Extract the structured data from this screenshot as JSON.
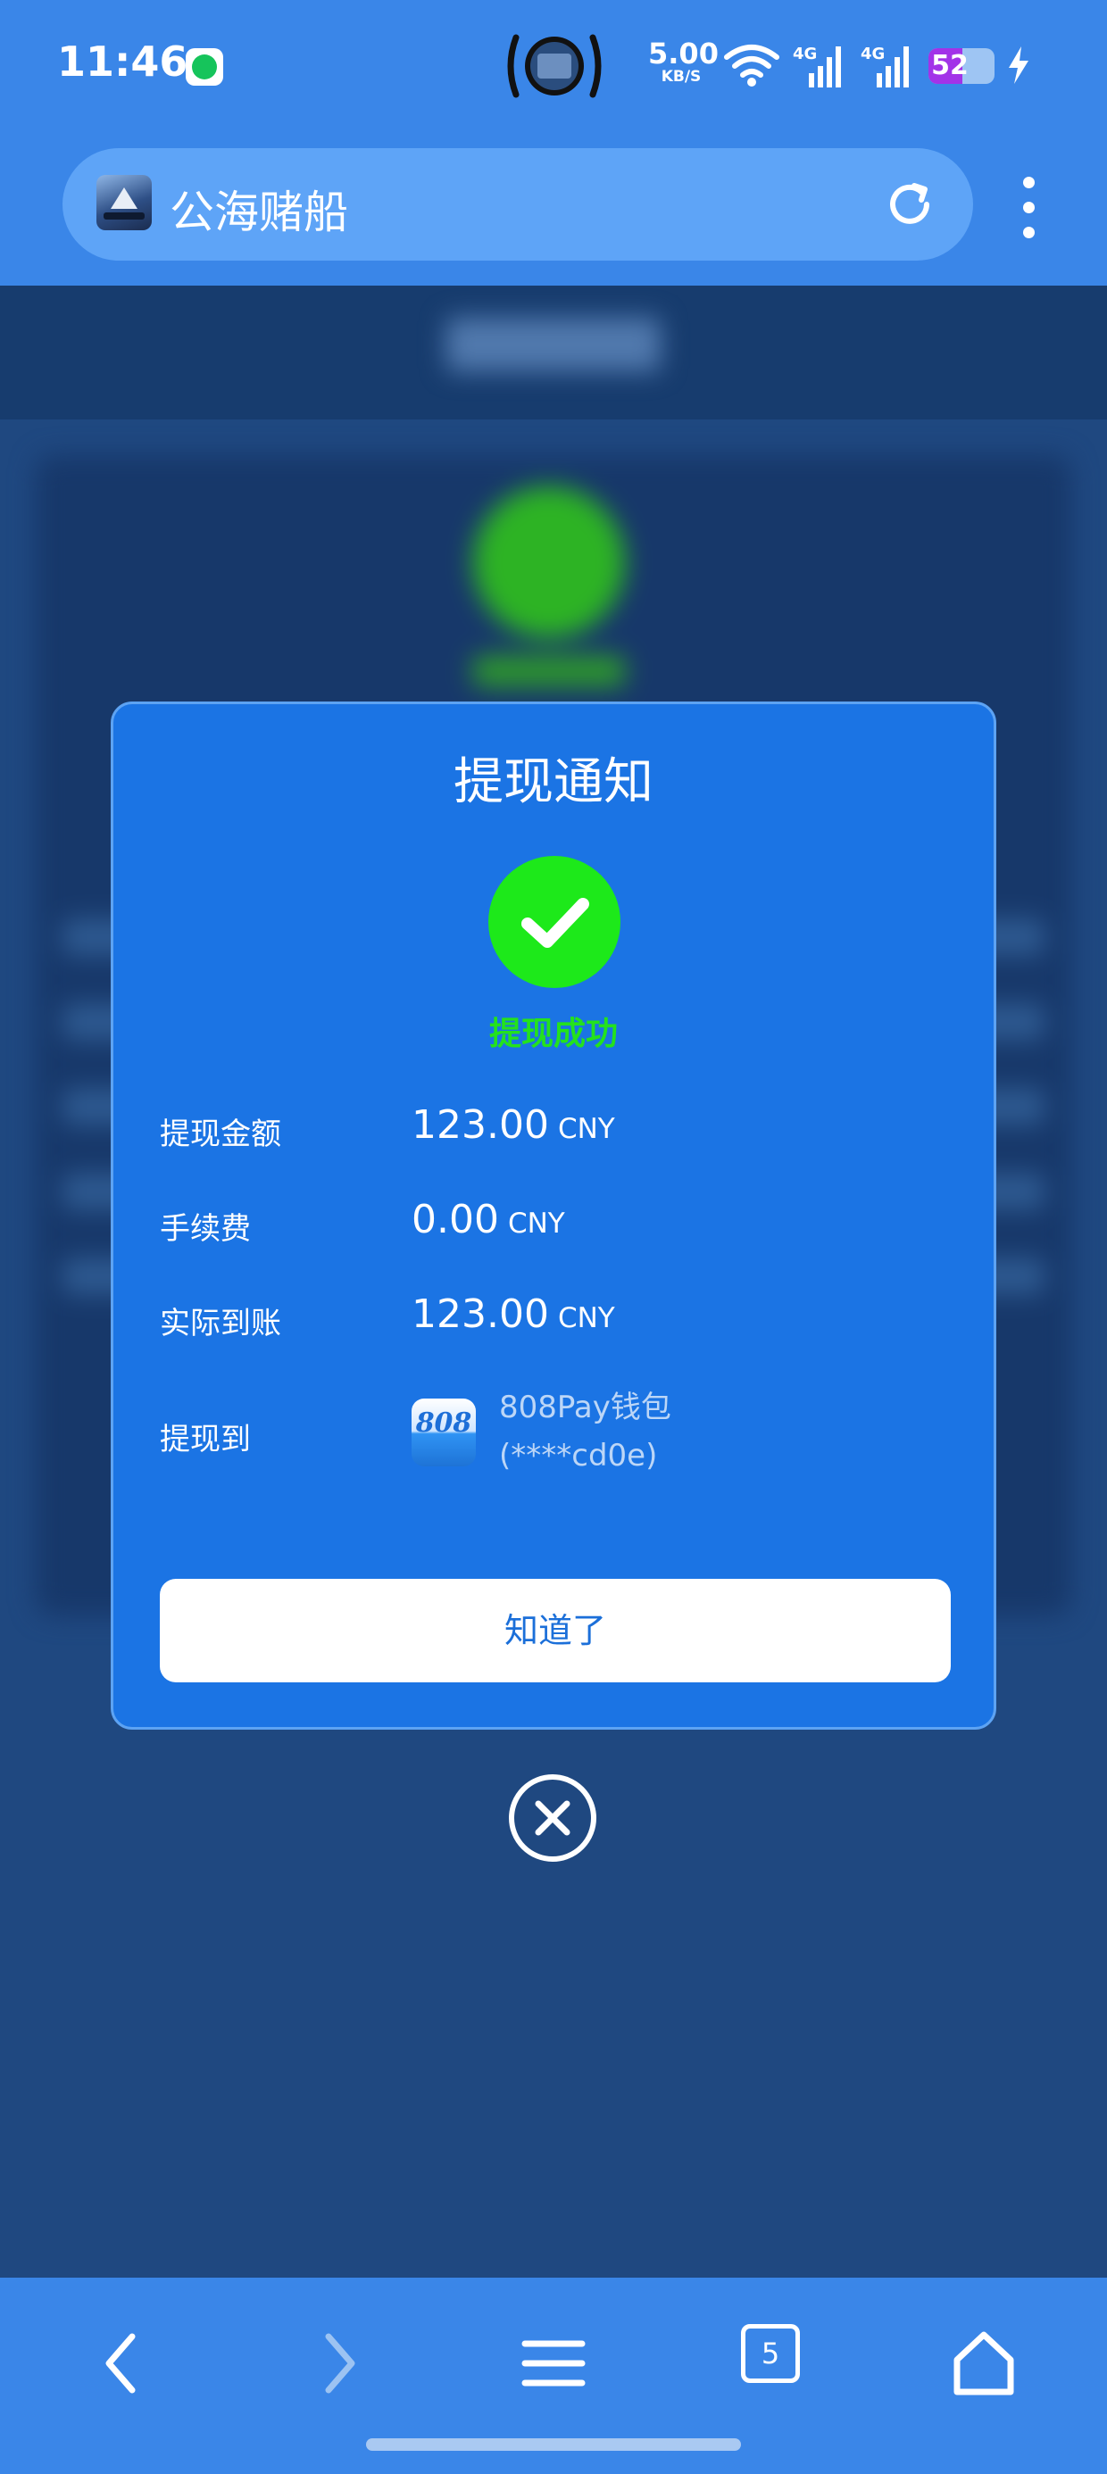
{
  "status_bar": {
    "time": "11:46",
    "network_speed_value": "5.00",
    "network_speed_unit": "KB/S",
    "signal_1_label": "4G",
    "signal_2_label": "4G",
    "battery_level": "52",
    "battery_fraction": 0.52
  },
  "browser": {
    "site_title": "公海赌船",
    "tab_count": "5"
  },
  "modal": {
    "title": "提现通知",
    "status_text": "提现成功",
    "rows": [
      {
        "label": "提现金额",
        "amount": "123.00",
        "currency": "CNY"
      },
      {
        "label": "手续费",
        "amount": "0.00",
        "currency": "CNY"
      },
      {
        "label": "实际到账",
        "amount": "123.00",
        "currency": "CNY"
      }
    ],
    "destination_label": "提现到",
    "wallet_logo_text": "808",
    "wallet_name": "808Pay钱包",
    "wallet_account": "(****cd0e)",
    "confirm_label": "知道了"
  },
  "colors": {
    "primary_blue": "#1b74e4",
    "bar_blue": "#3a86e8",
    "success_green": "#1de91a",
    "backdrop": "#1a4a8a"
  },
  "icons": {
    "reload": "reload-icon",
    "menu": "more-vertical-icon",
    "success": "checkmark-icon",
    "close": "close-circle-icon",
    "back": "chevron-left-icon",
    "forward": "chevron-right-icon",
    "nav_menu": "hamburger-icon",
    "home": "home-icon"
  }
}
